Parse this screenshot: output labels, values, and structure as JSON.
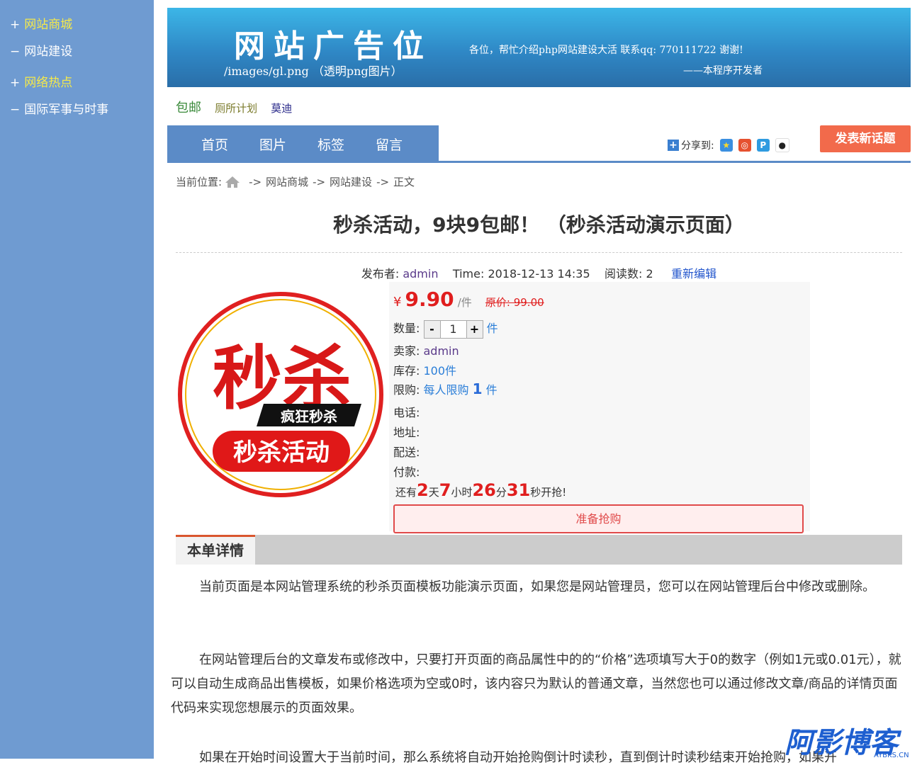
{
  "sidebar": {
    "items": [
      {
        "symbol": "+",
        "label": "网站商城"
      },
      {
        "symbol": "−",
        "label": "网站建设"
      },
      {
        "symbol": "+",
        "label": "网络热点"
      },
      {
        "symbol": "−",
        "label": "国际军事与时事"
      }
    ]
  },
  "banner": {
    "title": "网站广告位",
    "subtitle": "/images/gl.png （透明png图片）",
    "note": "各位，帮忙介绍php网站建设大活   联系qq: 770111722 谢谢!",
    "signature": "——本程序开发者"
  },
  "tags": [
    "包邮",
    "厕所计划",
    "莫迪"
  ],
  "nav": {
    "items": [
      "首页",
      "图片",
      "标签",
      "留言"
    ],
    "share_label": "分享到:",
    "post_button": "发表新话题"
  },
  "breadcrumb": {
    "prefix": "当前位置:",
    "sep": "->",
    "items": [
      "网站商城",
      "网站建设",
      "正文"
    ]
  },
  "article": {
    "title": "秒杀活动，9块9包邮！ （秒杀活动演示页面）",
    "publisher_label": "发布者:",
    "publisher": "admin",
    "time_label": "Time:",
    "time": "2018-12-13 14:35",
    "reads_label": "阅读数:",
    "reads": "2",
    "edit": "重新编辑"
  },
  "product": {
    "image_text": {
      "big": "秒杀",
      "band": "疯狂秒杀",
      "banner": "秒杀活动"
    },
    "currency": "¥",
    "price": "9.90",
    "price_unit": "/件",
    "original_price": "原价: 99.00",
    "qty_label": "数量:",
    "qty_minus": "-",
    "qty_value": "1",
    "qty_plus": "+",
    "qty_unit": "件",
    "seller_label": "卖家:",
    "seller": "admin",
    "stock_label": "库存:",
    "stock": "100件",
    "limit_label": "限购:",
    "limit_text": "每人限购",
    "limit_num": "1",
    "limit_unit": "件",
    "phone_label": "电话:",
    "address_label": "地址:",
    "delivery_label": "配送:",
    "payment_label": "付款:",
    "countdown": {
      "prefix": "还有",
      "days": "2",
      "days_label": "天",
      "hours": "7",
      "hours_label": "小时",
      "minutes": "26",
      "minutes_label": "分",
      "seconds": "31",
      "seconds_label": "秒开抢!"
    },
    "buy_button": "准备抢购"
  },
  "detail": {
    "tab": "本单详情",
    "paragraphs": [
      "当前页面是本网站管理系统的秒杀页面模板功能演示页面，如果您是网站管理员，您可以在网站管理后台中修改或删除。",
      "在网站管理后台的文章发布或修改中，只要打开页面的商品属性中的的“价格”选项填写大于0的数字（例如1元或0.01元），就可以自动生成商品出售模板，如果价格选项为空或0时，该内容只为默认的普通文章，当然您也可以通过修改文章/商品的详情页面代码来实现您想展示的页面效果。",
      "如果在开始时间设置大于当前时间，那么系统将自动开始抢购倒计时读秒，直到倒计时读秒结束开始抢购，如果开"
    ]
  },
  "watermark": {
    "text": "阿影博客",
    "sub": "AYBKS.CN"
  },
  "colors": {
    "sidebar": "#6f9bd1",
    "nav": "#5b8bc7",
    "accent_red": "#e01e1e",
    "post_button": "#f26a4b",
    "sidebar_hot": "#f5e94a"
  }
}
